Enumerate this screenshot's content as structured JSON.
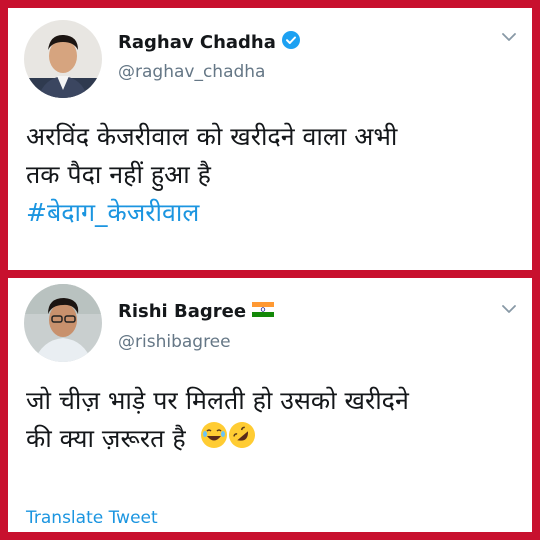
{
  "tweets": [
    {
      "name": "Raghav Chadha",
      "handle": "@raghav_chadha",
      "badge_icon": "verified-badge-icon",
      "lines": [
        "अरविंद केजरीवाल को खरीदने वाला अभी",
        "तक पैदा नहीं हुआ है"
      ],
      "hashtag": "#बेदाग_केजरीवाल"
    },
    {
      "name": "Rishi Bagree",
      "handle": "@rishibagree",
      "badge_icon": "india-flag-icon",
      "lines": [
        "जो चीज़ भाड़े पर मिलती हो उसको खरीदने",
        "की क्या ज़रूरत है"
      ],
      "emoji_icons": [
        "laughing-emoji-icon",
        "rolling-laughing-emoji-icon"
      ],
      "translate_link": "Translate Tweet"
    }
  ],
  "colors": {
    "frame": "#c8102e",
    "link": "#1b95e0",
    "handle": "#657786",
    "verified": "#1da1f2"
  }
}
